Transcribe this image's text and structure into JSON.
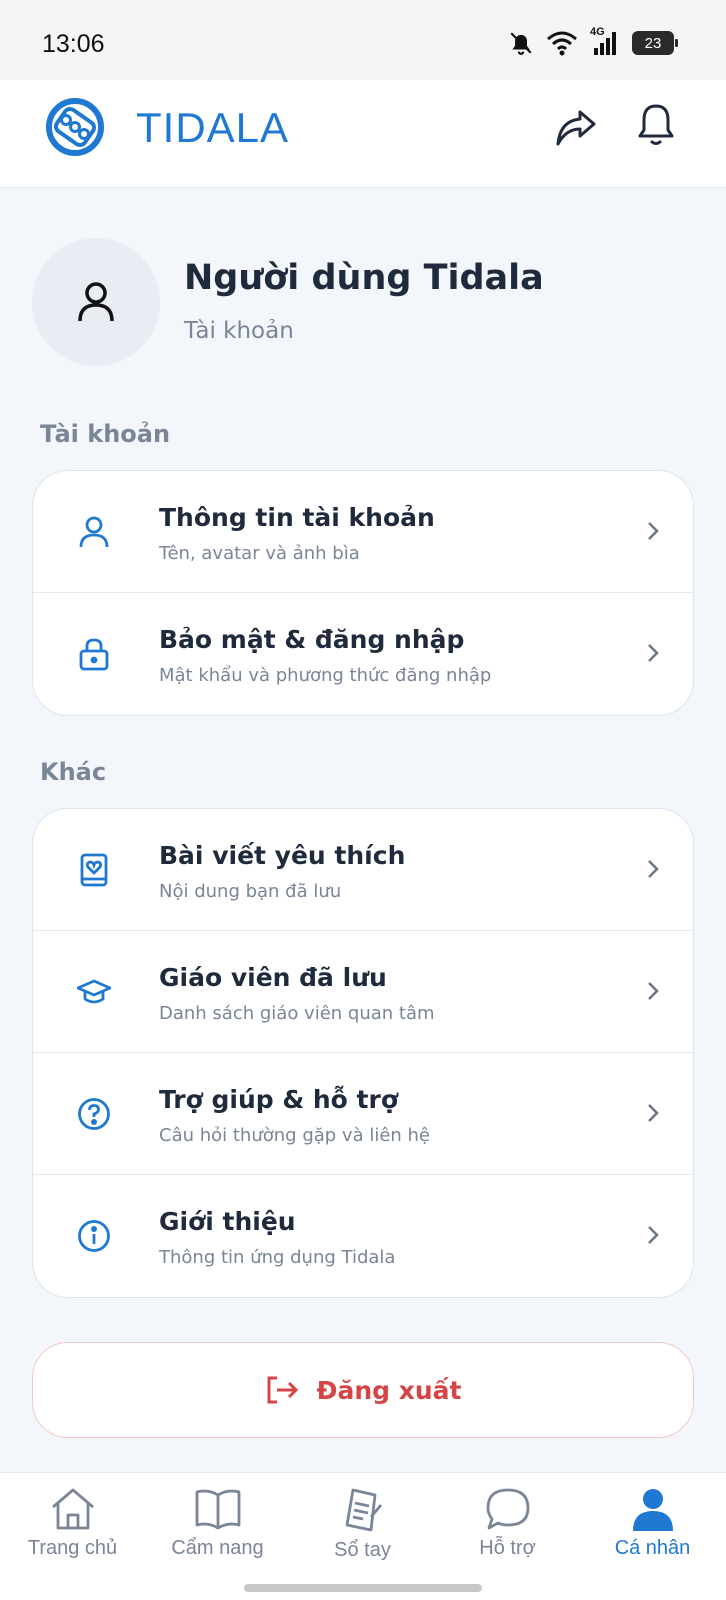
{
  "status_bar": {
    "time": "13:06",
    "network": "4G",
    "battery": "23"
  },
  "app_bar": {
    "brand": "TIDALA",
    "logo_icon": "tidala-logo-icon",
    "share_icon": "share-icon",
    "bell_icon": "bell-icon"
  },
  "profile": {
    "name": "Người dùng Tidala",
    "subtitle": "Tài khoản",
    "avatar_icon": "user-icon"
  },
  "sections": {
    "account": {
      "title": "Tài khoản",
      "items": [
        {
          "title": "Thông tin tài khoản",
          "subtitle": "Tên, avatar và ảnh bìa",
          "icon": "user-icon"
        },
        {
          "title": "Bảo mật & đăng nhập",
          "subtitle": "Mật khẩu và phương thức đăng nhập",
          "icon": "lock-icon"
        }
      ]
    },
    "other": {
      "title": "Khác",
      "items": [
        {
          "title": "Bài viết yêu thích",
          "subtitle": "Nội dung bạn đã lưu",
          "icon": "bookmark-heart-icon"
        },
        {
          "title": "Giáo viên đã lưu",
          "subtitle": "Danh sách giáo viên quan tâm",
          "icon": "graduation-cap-icon"
        },
        {
          "title": "Trợ giúp & hỗ trợ",
          "subtitle": "Câu hỏi thường gặp và liên hệ",
          "icon": "help-circle-icon"
        },
        {
          "title": "Giới thiệu",
          "subtitle": "Thông tin ứng dụng Tidala",
          "icon": "info-icon"
        }
      ]
    }
  },
  "logout": {
    "label": "Đăng xuất",
    "icon": "logout-icon"
  },
  "bottom_nav": [
    {
      "label": "Trang chủ",
      "icon": "home-icon",
      "active": false
    },
    {
      "label": "Cẩm nang",
      "icon": "book-icon",
      "active": false
    },
    {
      "label": "Sổ tay",
      "icon": "notebook-icon",
      "active": false
    },
    {
      "label": "Hỗ trợ",
      "icon": "chat-icon",
      "active": false
    },
    {
      "label": "Cá nhân",
      "icon": "person-icon",
      "active": true
    }
  ],
  "colors": {
    "accent": "#1f78d1",
    "danger": "#d64545",
    "text": "#1f2a3d",
    "muted": "#7a8597",
    "background": "#f3f6fa"
  }
}
